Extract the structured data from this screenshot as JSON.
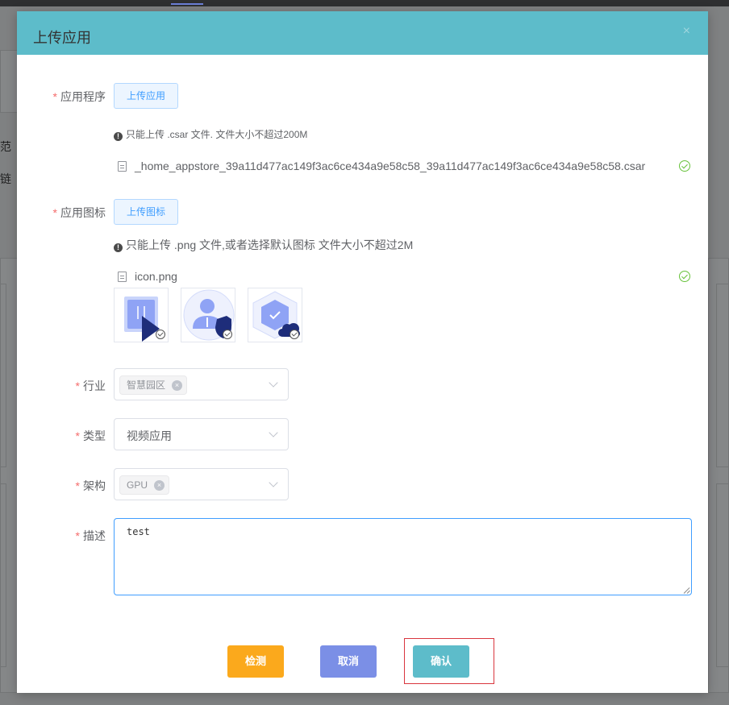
{
  "modal": {
    "title": "上传应用",
    "close_glyph": "×"
  },
  "background": {
    "fragment_1": "范",
    "fragment_2": "链"
  },
  "form": {
    "app": {
      "label": "应用程序",
      "required_mark": "*",
      "button_label": "上传应用",
      "tip": "只能上传 .csar 文件. 文件大小不超过200M",
      "file_name": "_home_appstore_39a11d477ac149f3ac6ce434a9e58c58_39a11d477ac149f3ac6ce434a9e58c58.csar",
      "file_status": "check-circle-icon"
    },
    "icon": {
      "label": "应用图标",
      "required_mark": "*",
      "button_label": "上传图标",
      "tip": "只能上传 .png 文件,或者选择默认图标 文件大小不超过2M",
      "file_name": "icon.png",
      "file_status": "check-circle-icon",
      "default_icons": [
        "video-app-icon",
        "user-shield-icon",
        "hexagon-cloud-icon"
      ]
    },
    "industry": {
      "label": "行业",
      "required_mark": "*",
      "tag": "智慧园区",
      "tag_close_glyph": "×"
    },
    "type": {
      "label": "类型",
      "required_mark": "*",
      "value": "视频应用"
    },
    "arch": {
      "label": "架构",
      "required_mark": "*",
      "tag": "GPU",
      "tag_close_glyph": "×"
    },
    "desc": {
      "label": "描述",
      "required_mark": "*",
      "value": "test"
    }
  },
  "footer": {
    "check_label": "检测",
    "cancel_label": "取消",
    "confirm_label": "确认"
  },
  "colors": {
    "header": "#5dbcca",
    "check_button": "#fba91c",
    "cancel_button": "#7b8fe6",
    "confirm_button": "#5dbcca",
    "highlight": "#d9363e"
  }
}
